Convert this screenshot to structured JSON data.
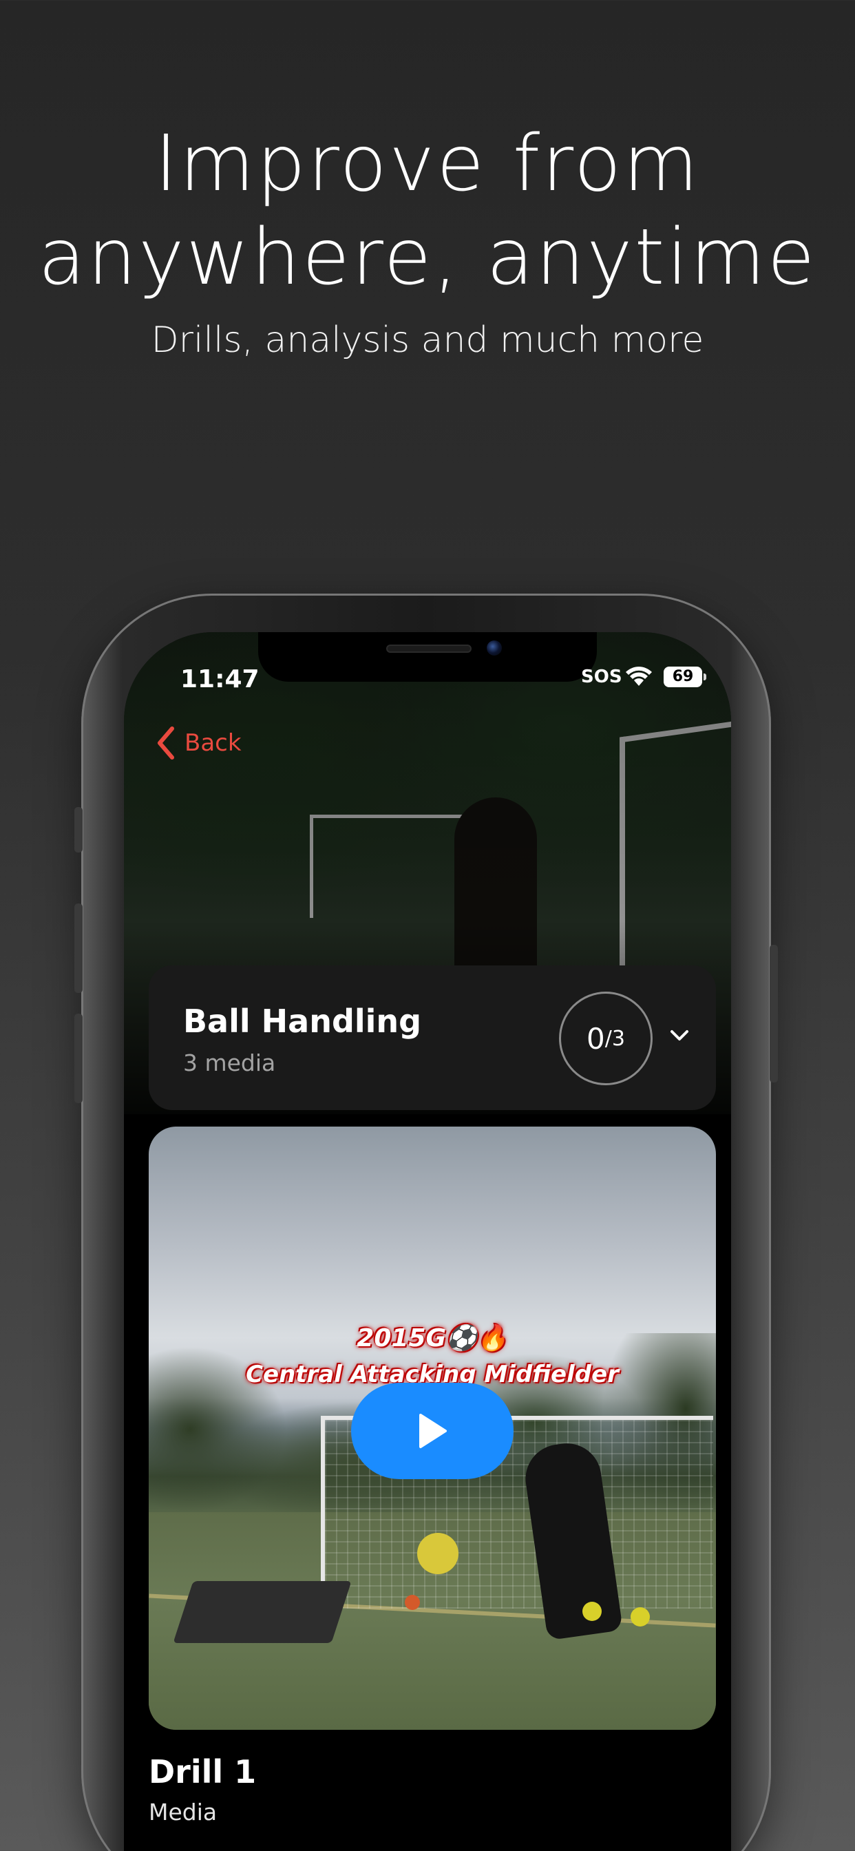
{
  "hero": {
    "title_line1": "Improve from",
    "title_line2": "anywhere, anytime",
    "subtitle": "Drills, analysis and much more"
  },
  "status_bar": {
    "time": "11:47",
    "carrier": "SOS",
    "battery": "69"
  },
  "nav": {
    "back_label": "Back",
    "accent_color": "#e94a3f"
  },
  "collection": {
    "title": "Ball Handling",
    "media_count": "3 media",
    "progress_done": "0",
    "progress_total": "/3"
  },
  "video": {
    "overlay_line1": "2015G⚽🔥",
    "overlay_line2": "Central Attacking Midfielder",
    "play_color": "#1a8cff"
  },
  "drill": {
    "title": "Drill 1",
    "subtitle": "Media"
  }
}
